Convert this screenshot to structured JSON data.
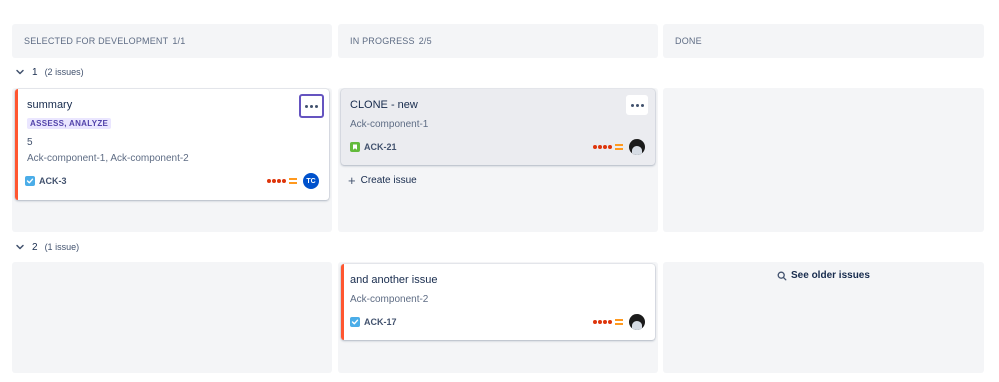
{
  "columns": [
    {
      "name": "SELECTED FOR DEVELOPMENT",
      "count": "1/1"
    },
    {
      "name": "IN PROGRESS",
      "count": "2/5"
    },
    {
      "name": "DONE",
      "count": ""
    }
  ],
  "swimlanes": [
    {
      "name": "1",
      "count": "(2 issues)"
    },
    {
      "name": "2",
      "count": "(1 issue)"
    }
  ],
  "cards": {
    "summary": {
      "title": "summary",
      "epic": "ASSESS, ANALYZE",
      "estimate": "5",
      "components": "Ack-component-1, Ack-component-2",
      "key": "ACK-3",
      "type_icon": "task-icon",
      "avatar": "TC",
      "priority": "highest"
    },
    "clone": {
      "title": "CLONE - new",
      "components": "Ack-component-1",
      "key": "ACK-21",
      "type_icon": "story-icon",
      "priority": "highest"
    },
    "another": {
      "title": "and another issue",
      "components": "Ack-component-2",
      "key": "ACK-17",
      "type_icon": "task-icon",
      "priority": "highest"
    }
  },
  "create_issue": "Create issue",
  "see_older": "See older issues",
  "colors": {
    "flag": "#ff5630",
    "epic_text": "#5243aa",
    "epic_bg": "#eae6ff",
    "priority": "#de350b",
    "avatar_tc": "#0052cc",
    "task_icon": "#4bade8",
    "story_icon": "#63ba3c"
  }
}
